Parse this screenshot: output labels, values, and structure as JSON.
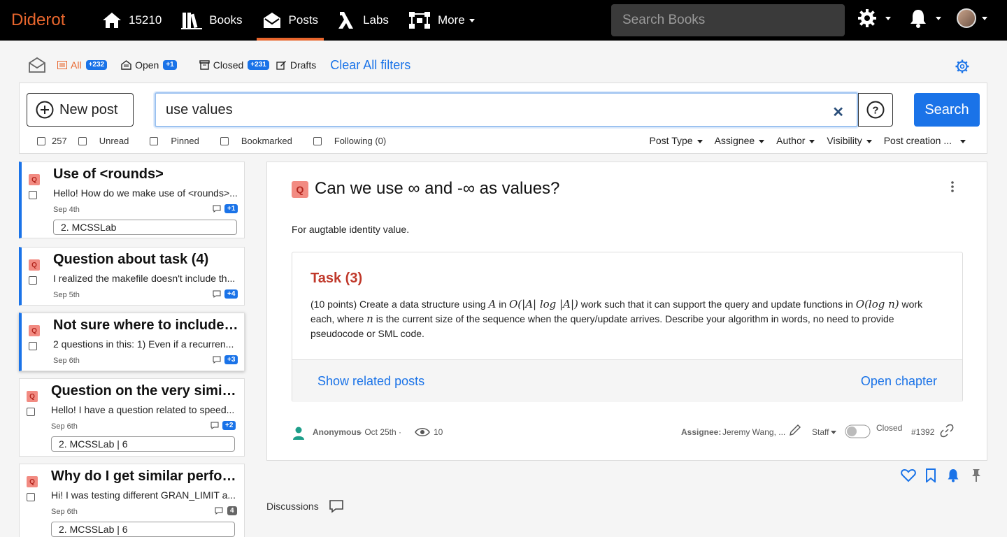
{
  "topbar": {
    "brand": "Diderot",
    "home_count": "15210",
    "books": "Books",
    "posts": "Posts",
    "labs": "Labs",
    "more": "More",
    "search_placeholder": "Search Books"
  },
  "filters": {
    "all": "All",
    "all_count": "+232",
    "open": "Open",
    "open_count": "+1",
    "closed": "Closed",
    "closed_count": "+231",
    "drafts": "Drafts",
    "clear": "Clear All filters"
  },
  "search": {
    "new_post": "New post",
    "query": "use values",
    "search_button": "Search",
    "checks": [
      "257",
      "Unread",
      "Pinned",
      "Bookmarked",
      "Following (0)"
    ],
    "dropdowns": [
      "Post Type",
      "Assignee",
      "Author",
      "Visibility",
      "Post creation ..."
    ]
  },
  "posts": [
    {
      "title": "Use of <rounds>",
      "snippet": "Hello! How do we make use of <rounds>...",
      "date": "Sep 4th",
      "count": "+1",
      "tag": "2. MCSSLab"
    },
    {
      "title": "Question about task (4)",
      "snippet": "I realized the makefile doesn't include th...",
      "date": "Sep 5th",
      "count": "+4",
      "tag": ""
    },
    {
      "title": "Not sure where to include c...",
      "snippet": "2 questions in this: 1) Even if a recurren...",
      "date": "Sep 6th",
      "count": "+3",
      "tag": ""
    },
    {
      "title": "Question on the very simila...",
      "snippet": "Hello! I have a question related to speed...",
      "date": "Sep 6th",
      "count": "+2",
      "tag": "2. MCSSLab  |  6"
    },
    {
      "title": "Why do I get similar perfor...",
      "snippet": "Hi! I was testing different GRAN_LIMIT a...",
      "date": "Sep 6th",
      "count": "4",
      "tag": "2. MCSSLab  |  6"
    }
  ],
  "main": {
    "q": "Q",
    "title": "Can we use ∞ and -∞ as values?",
    "body": "For augtable identity value.",
    "task_title": "Task (3)",
    "task_p1": "(10 points) Create a data structure using ",
    "task_m1": "A",
    "task_p2": " in ",
    "task_m2": "O(|A| log |A|)",
    "task_p3": " work such that it can support the query and update functions in ",
    "task_m3": "O(log n)",
    "task_p4": " work each, where ",
    "task_m4": "n",
    "task_p5": " is the current size of the sequence when the query/update arrives. Describe your algorithm in words, no need to provide pseudocode or SML code.",
    "show_related": "Show related posts",
    "open_chapter": "Open chapter",
    "author": "Anonymous",
    "date": "·  Oct 25th  ·",
    "views": "10",
    "assignee_label": "Assignee:",
    "assignee": "Jeremy Wang, ...",
    "staff": "Staff",
    "status": "Closed",
    "post_id": "#1392"
  },
  "discussions": "Discussions",
  "colors": {
    "accent": "#1a73e8",
    "brand": "#e8662d",
    "task": "#c0392b"
  }
}
